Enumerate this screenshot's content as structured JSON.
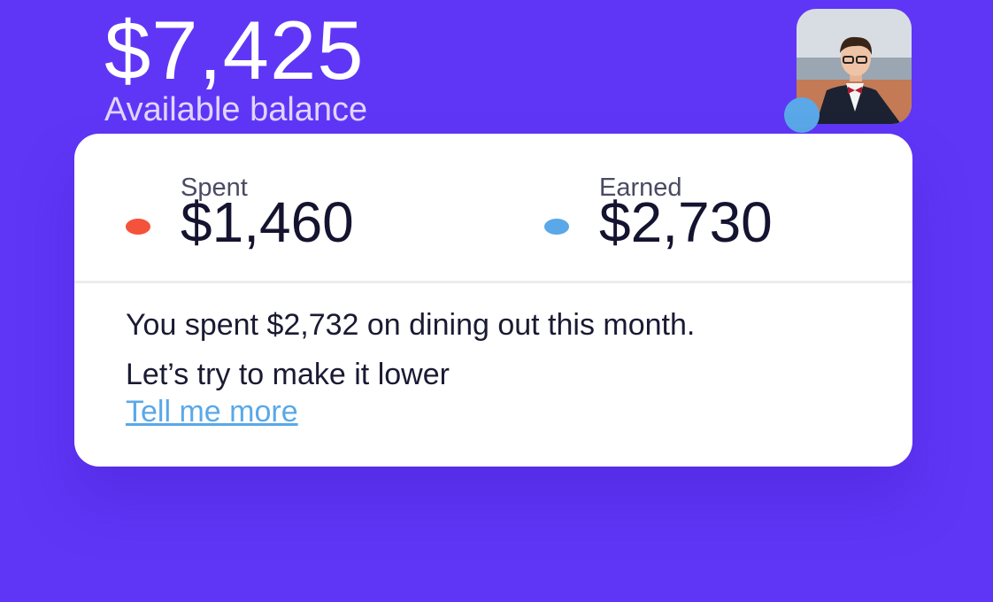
{
  "balance": {
    "amount": "$7,425",
    "label": "Available balance"
  },
  "profile": {
    "avatar_icon": "user-photo",
    "status_color": "#5aa8e8"
  },
  "summary": {
    "spent": {
      "label": "Spent",
      "value": "$1,460",
      "color": "#f5523b"
    },
    "earned": {
      "label": "Earned",
      "value": "$2,730",
      "color": "#5aa8e8"
    }
  },
  "insight": {
    "line1": "You spent $2,732 on dining out this month.",
    "line2": "Let’s try to make it lower",
    "link": "Tell me more"
  },
  "colors": {
    "background": "#5f36f6",
    "card": "#ffffff",
    "link": "#5aa8e8"
  }
}
